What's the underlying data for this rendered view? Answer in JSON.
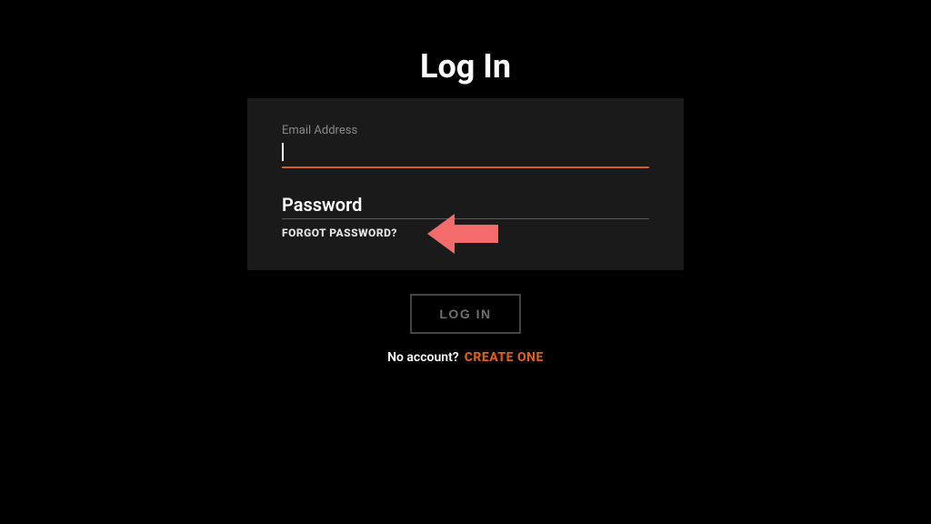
{
  "title": "Log In",
  "form": {
    "email_label": "Email Address",
    "email_value": "",
    "password_label": "Password",
    "forgot_label": "FORGOT PASSWORD?"
  },
  "actions": {
    "login_button": "LOG IN"
  },
  "footer": {
    "no_account_text": "No account?",
    "create_link": "CREATE ONE"
  },
  "colors": {
    "accent": "#d9601a",
    "arrow": "#f36b6b"
  }
}
